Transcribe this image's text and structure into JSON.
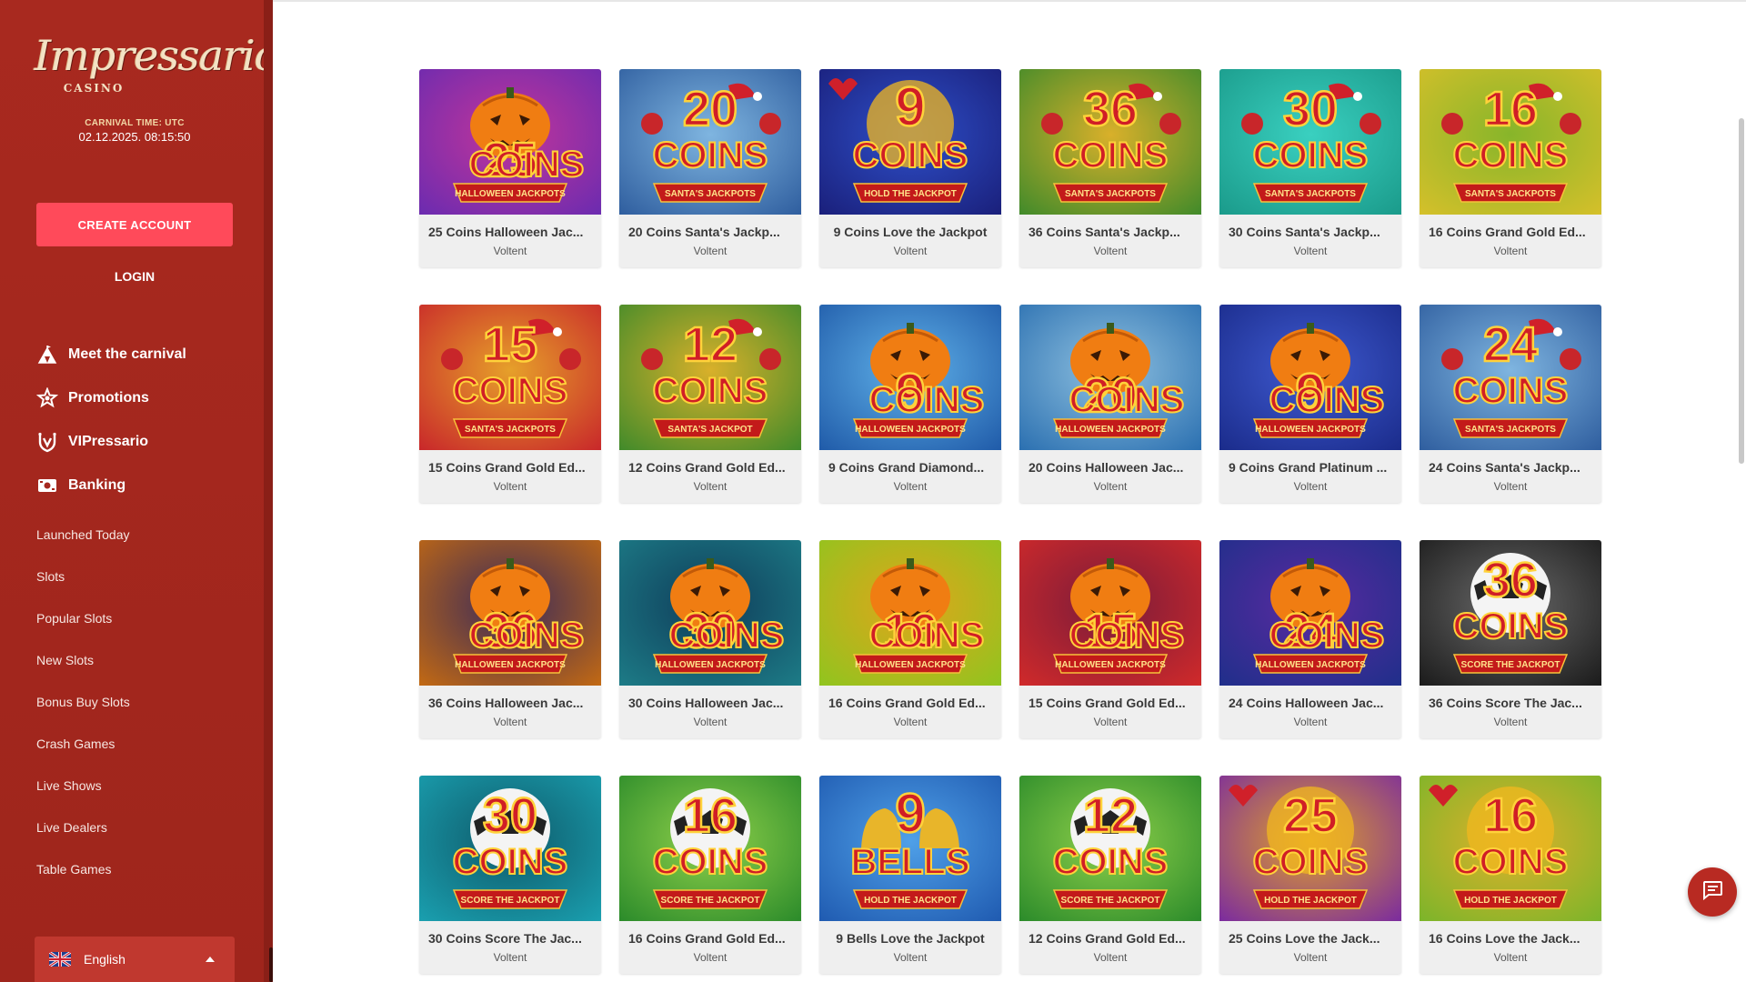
{
  "brand": {
    "name": "Impressario",
    "sub": "CASINO"
  },
  "clock": {
    "label": "CARNIVAL TIME: UTC",
    "value": "02.12.2025. 08:15:50"
  },
  "auth": {
    "create_account": "CREATE ACCOUNT",
    "login": "LOGIN"
  },
  "main_nav": [
    {
      "label": "Meet the carnival",
      "icon": "tent-icon"
    },
    {
      "label": "Promotions",
      "icon": "star-badge-icon"
    },
    {
      "label": "VIPressario",
      "icon": "vip-shield-icon"
    },
    {
      "label": "Banking",
      "icon": "cash-icon"
    }
  ],
  "sub_nav": [
    "Launched Today",
    "Slots",
    "Popular Slots",
    "New Slots",
    "Bonus Buy Slots",
    "Crash Games",
    "Live Shows",
    "Live Dealers",
    "Table Games"
  ],
  "language": {
    "selected": "English",
    "flag": "uk-flag-icon"
  },
  "colors": {
    "sidebar": "#a5281f",
    "create_button": "#ff4a5a",
    "language_bar": "#c0382f",
    "chat_button": "#b82a22"
  },
  "games": [
    {
      "title": "25 Coins Halloween Jac...",
      "provider": "Voltent",
      "number": "25",
      "word": "COINS",
      "ribbon": "HALLOWEEN JACKPOTS",
      "theme": "halloween"
    },
    {
      "title": "20 Coins Santa's Jackp...",
      "provider": "Voltent",
      "number": "20",
      "word": "COINS",
      "ribbon": "SANTA'S JACKPOTS",
      "theme": "santa-blue"
    },
    {
      "title": "9 Coins Love the Jackpot",
      "provider": "Voltent",
      "number": "9",
      "word": "COINS",
      "ribbon": "HOLD THE JACKPOT",
      "theme": "love"
    },
    {
      "title": "36 Coins Santa's Jackp...",
      "provider": "Voltent",
      "number": "36",
      "word": "COINS",
      "ribbon": "SANTA'S JACKPOTS",
      "theme": "santa-green"
    },
    {
      "title": "30 Coins Santa's Jackp...",
      "provider": "Voltent",
      "number": "30",
      "word": "COINS",
      "ribbon": "SANTA'S JACKPOTS",
      "theme": "santa-teal"
    },
    {
      "title": "16 Coins Grand Gold Ed...",
      "provider": "Voltent",
      "number": "16",
      "word": "COINS",
      "ribbon": "SANTA'S JACKPOTS",
      "theme": "santa-gold"
    },
    {
      "title": "15 Coins Grand Gold Ed...",
      "provider": "Voltent",
      "number": "15",
      "word": "COINS",
      "ribbon": "SANTA'S JACKPOTS",
      "theme": "santa-red"
    },
    {
      "title": "12 Coins Grand Gold Ed...",
      "provider": "Voltent",
      "number": "12",
      "word": "COINS",
      "ribbon": "SANTA'S JACKPOT",
      "theme": "santa-green"
    },
    {
      "title": "9 Coins Grand Diamond...",
      "provider": "Voltent",
      "number": "9",
      "word": "COINS",
      "ribbon": "HALLOWEEN JACKPOTS",
      "theme": "diamond"
    },
    {
      "title": "20 Coins Halloween Jac...",
      "provider": "Voltent",
      "number": "20",
      "word": "COINS",
      "ribbon": "HALLOWEEN JACKPOTS",
      "theme": "halloween-blue"
    },
    {
      "title": "9 Coins Grand Platinum ...",
      "provider": "Voltent",
      "number": "9",
      "word": "COINS",
      "ribbon": "HALLOWEEN JACKPOTS",
      "theme": "platinum"
    },
    {
      "title": "24 Coins Santa's Jackp...",
      "provider": "Voltent",
      "number": "24",
      "word": "COINS",
      "ribbon": "SANTA'S JACKPOTS",
      "theme": "santa-blue"
    },
    {
      "title": "36 Coins Halloween Jac...",
      "provider": "Voltent",
      "number": "36",
      "word": "COINS",
      "ribbon": "HALLOWEEN JACKPOTS",
      "theme": "halloween-orange"
    },
    {
      "title": "30 Coins Halloween Jac...",
      "provider": "Voltent",
      "number": "30",
      "word": "COINS",
      "ribbon": "HALLOWEEN JACKPOTS",
      "theme": "halloween-teal"
    },
    {
      "title": "16 Coins Grand Gold Ed...",
      "provider": "Voltent",
      "number": "16",
      "word": "COINS",
      "ribbon": "HALLOWEEN JACKPOTS",
      "theme": "halloween-lime"
    },
    {
      "title": "15 Coins Grand Gold Ed...",
      "provider": "Voltent",
      "number": "15",
      "word": "COINS",
      "ribbon": "HALLOWEEN JACKPOTS",
      "theme": "halloween-red"
    },
    {
      "title": "24 Coins Halloween Jac...",
      "provider": "Voltent",
      "number": "24",
      "word": "COINS",
      "ribbon": "HALLOWEEN JACKPOTS",
      "theme": "halloween-navy"
    },
    {
      "title": "36 Coins Score The Jac...",
      "provider": "Voltent",
      "number": "36",
      "word": "COINS",
      "ribbon": "SCORE THE JACKPOT",
      "theme": "soccer-dark"
    },
    {
      "title": "30 Coins Score The Jac...",
      "provider": "Voltent",
      "number": "30",
      "word": "COINS",
      "ribbon": "SCORE THE JACKPOT",
      "theme": "soccer-teal"
    },
    {
      "title": "16 Coins Grand Gold Ed...",
      "provider": "Voltent",
      "number": "16",
      "word": "COINS",
      "ribbon": "SCORE THE JACKPOT",
      "theme": "soccer-green"
    },
    {
      "title": "9 Bells Love the Jackpot",
      "provider": "Voltent",
      "number": "9",
      "word": "BELLS",
      "ribbon": "HOLD THE JACKPOT",
      "theme": "bells"
    },
    {
      "title": "12 Coins Grand Gold Ed...",
      "provider": "Voltent",
      "number": "12",
      "word": "COINS",
      "ribbon": "SCORE THE JACKPOT",
      "theme": "soccer-green"
    },
    {
      "title": "25 Coins Love the Jack...",
      "provider": "Voltent",
      "number": "25",
      "word": "COINS",
      "ribbon": "HOLD THE JACKPOT",
      "theme": "love-purple"
    },
    {
      "title": "16 Coins Love the Jack...",
      "provider": "Voltent",
      "number": "16",
      "word": "COINS",
      "ribbon": "HOLD THE JACKPOT",
      "theme": "love-green"
    }
  ],
  "chat": {
    "icon": "chat-icon"
  }
}
